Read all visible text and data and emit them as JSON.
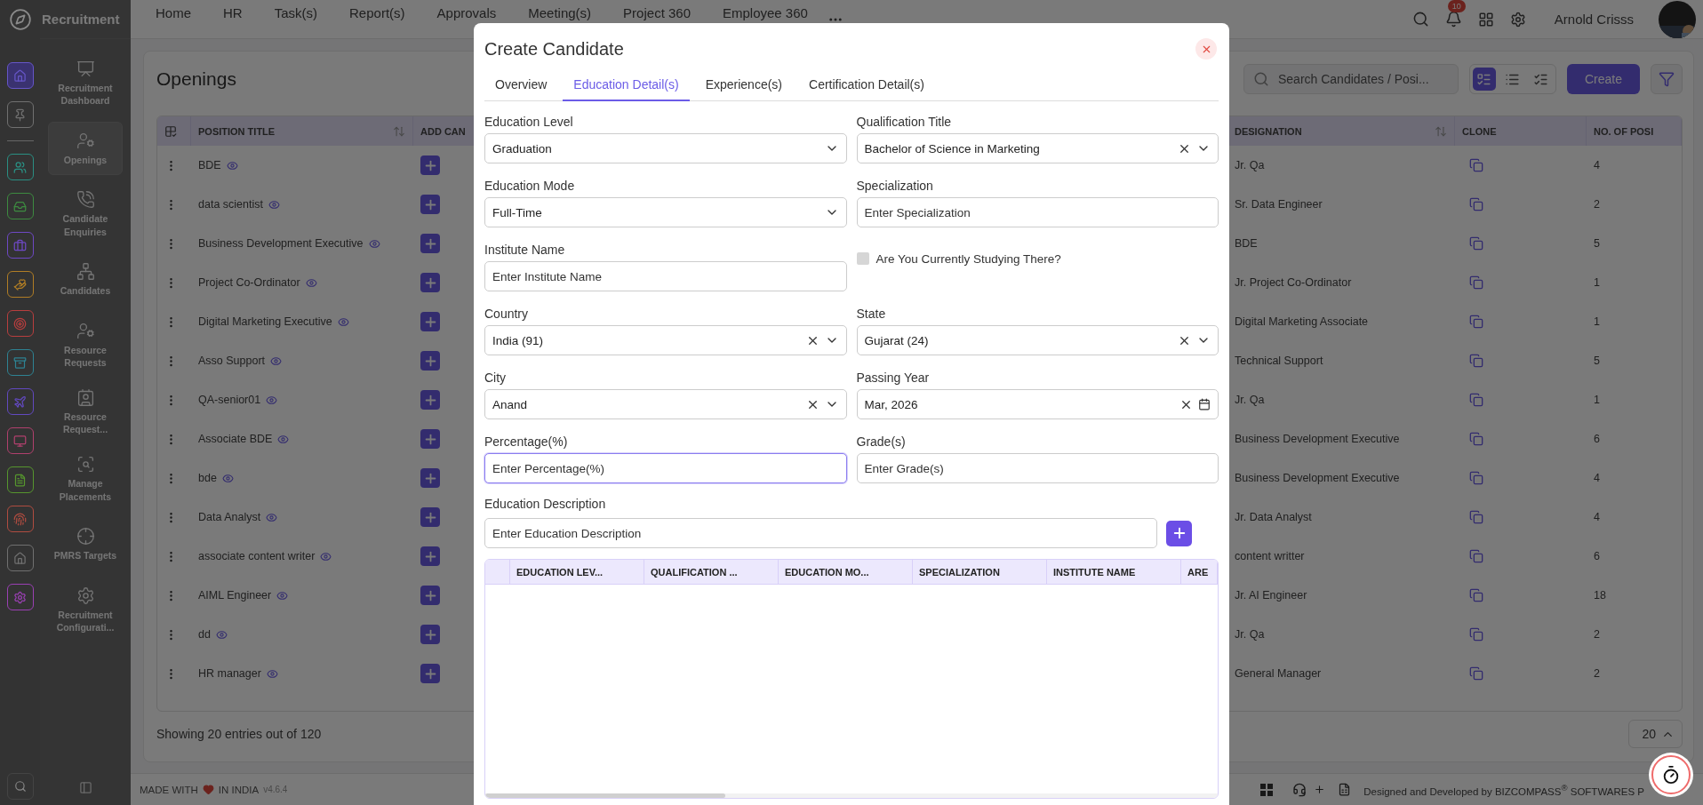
{
  "app": {
    "title": "Recruitment"
  },
  "rail": {
    "pinned": [
      {
        "color": "#6656c8",
        "selected": true
      },
      {
        "color": "#707070",
        "selected": false
      }
    ],
    "modules": [
      {
        "color": "#2a8f83",
        "selected": false
      },
      {
        "color": "#3d8b40",
        "selected": false
      },
      {
        "color": "#6e48c4",
        "selected": false
      },
      {
        "color": "#b07d25",
        "selected": false
      },
      {
        "color": "#b83e3e",
        "selected": false
      },
      {
        "color": "#2e8393",
        "selected": false
      },
      {
        "color": "#6249c0",
        "selected": false
      },
      {
        "color": "#b0406d",
        "selected": false
      },
      {
        "color": "#56962e",
        "selected": false
      },
      {
        "color": "#b04c40",
        "selected": false
      },
      {
        "color": "#707070",
        "selected": false
      },
      {
        "color": "#9a40b3",
        "selected": false
      }
    ]
  },
  "sidebar": {
    "items": [
      {
        "label": "Recruitment Dashboard",
        "selected": false
      },
      {
        "label": "Openings",
        "selected": true
      },
      {
        "label": "Candidate Enquiries",
        "selected": false
      },
      {
        "label": "Candidates",
        "selected": false
      },
      {
        "label": "Resource Requests",
        "selected": false
      },
      {
        "label": "Resource Request...",
        "selected": false
      },
      {
        "label": "Manage Placements",
        "selected": false
      },
      {
        "label": "PMRS Targets",
        "selected": false
      },
      {
        "label": "Recruitment Configurati...",
        "selected": false
      }
    ]
  },
  "topnav": {
    "items": [
      "Home",
      "HR",
      "Task(s)",
      "Report(s)",
      "Approvals",
      "Meeting(s)",
      "Project 360",
      "Employee 360"
    ]
  },
  "user": {
    "name": "Arnold Crisss",
    "notifications": "10"
  },
  "page": {
    "title": "Openings",
    "search": {
      "placeholder": "Search Candidates / Posi..."
    },
    "views": [
      {
        "selected": true
      },
      {
        "selected": false
      },
      {
        "selected": false
      }
    ],
    "create": "Create"
  },
  "table": {
    "columns": [
      {
        "label": "POSITION TITLE",
        "sortable": true
      },
      {
        "label": "ADD CAN"
      },
      {
        "label": "DESIGNATION",
        "sortable": true
      },
      {
        "label": "CLONE",
        "sortable": false
      },
      {
        "label": "NO. OF POSI",
        "sortable": false
      }
    ],
    "rows": [
      {
        "position": "BDE",
        "designation": "Jr. Qa",
        "count": "4"
      },
      {
        "position": "data scientist",
        "designation": "Sr. Data Engineer",
        "count": "2"
      },
      {
        "position": "Business Development Executive",
        "designation": "BDE",
        "count": "5"
      },
      {
        "position": "Project Co-Ordinator",
        "designation": "Jr. Project Co-Ordinator",
        "count": "1"
      },
      {
        "position": "Digital Marketing Executive",
        "designation": "Digital Marketing Associate",
        "count": "1"
      },
      {
        "position": "Asso Support",
        "designation": "Technical Support",
        "count": "5"
      },
      {
        "position": "QA-senior01",
        "designation": "Jr. Qa",
        "count": "1"
      },
      {
        "position": "Associate BDE",
        "designation": "Business Development Executive",
        "count": "6"
      },
      {
        "position": "bde",
        "designation": "Business Development Executive",
        "count": "4"
      },
      {
        "position": "Data Analyst",
        "designation": "Jr. Data Analyst",
        "count": "4"
      },
      {
        "position": "associate content writer",
        "designation": "content writter",
        "count": "6"
      },
      {
        "position": "AIML Engineer",
        "designation": "Jr. AI Engineer",
        "count": "18"
      },
      {
        "position": "dd",
        "designation": "Jr. Qa",
        "count": "2"
      },
      {
        "position": "HR manager",
        "designation": "General Manager",
        "count": "2"
      }
    ]
  },
  "footer": {
    "summary": "Showing 20 entries out of 120",
    "page_size": "20"
  },
  "bottom_bar": {
    "made_with": "MADE WITH",
    "in_india": "IN INDIA",
    "version": "v4.6.4",
    "credit": "Designed and Developed by BIZCOMPASS$^{®}$ SOFTWARES P"
  },
  "modal": {
    "title": "Create Candidate",
    "tabs": [
      {
        "label": "Overview",
        "selected": false
      },
      {
        "label": "Education Detail(s)",
        "selected": true
      },
      {
        "label": "Experience(s)",
        "selected": false
      },
      {
        "label": "Certification Detail(s)",
        "selected": false
      }
    ],
    "fields": [
      {
        "kind": "select",
        "label": "Education Level",
        "value": "Graduation",
        "clearable": false
      },
      {
        "kind": "select",
        "label": "Qualification Title",
        "value": "Bachelor of Science in Marketing",
        "clearable": true
      },
      {
        "kind": "select",
        "label": "Education Mode",
        "value": "Full-Time",
        "clearable": false
      },
      {
        "kind": "input",
        "label": "Specialization",
        "placeholder": "Enter Specialization",
        "focused": false
      },
      {
        "kind": "input",
        "label": "Institute Name",
        "placeholder": "Enter Institute Name",
        "focused": false
      },
      {
        "kind": "checkbox",
        "label": "Are You Currently Studying There?",
        "checked": false
      },
      {
        "kind": "select",
        "label": "Country",
        "value": "India (91)",
        "clearable": true
      },
      {
        "kind": "select",
        "label": "State",
        "value": "Gujarat (24)",
        "clearable": true
      },
      {
        "kind": "select",
        "label": "City",
        "value": "Anand",
        "clearable": true
      },
      {
        "kind": "date",
        "label": "Passing Year",
        "value": "Mar, 2026",
        "clearable": true
      },
      {
        "kind": "input",
        "label": "Percentage(%)",
        "placeholder": "Enter Percentage(%)",
        "focused": true
      },
      {
        "kind": "input",
        "label": "Grade(s)",
        "placeholder": "Enter Grade(s)",
        "focused": false
      }
    ],
    "description": {
      "label": "Education Description",
      "placeholder": "Enter Education Description"
    },
    "table": {
      "columns": [
        "EDUCATION LEV...",
        "QUALIFICATION ...",
        "EDUCATION MO...",
        "SPECIALIZATION",
        "INSTITUTE NAME",
        "ARE"
      ]
    }
  }
}
